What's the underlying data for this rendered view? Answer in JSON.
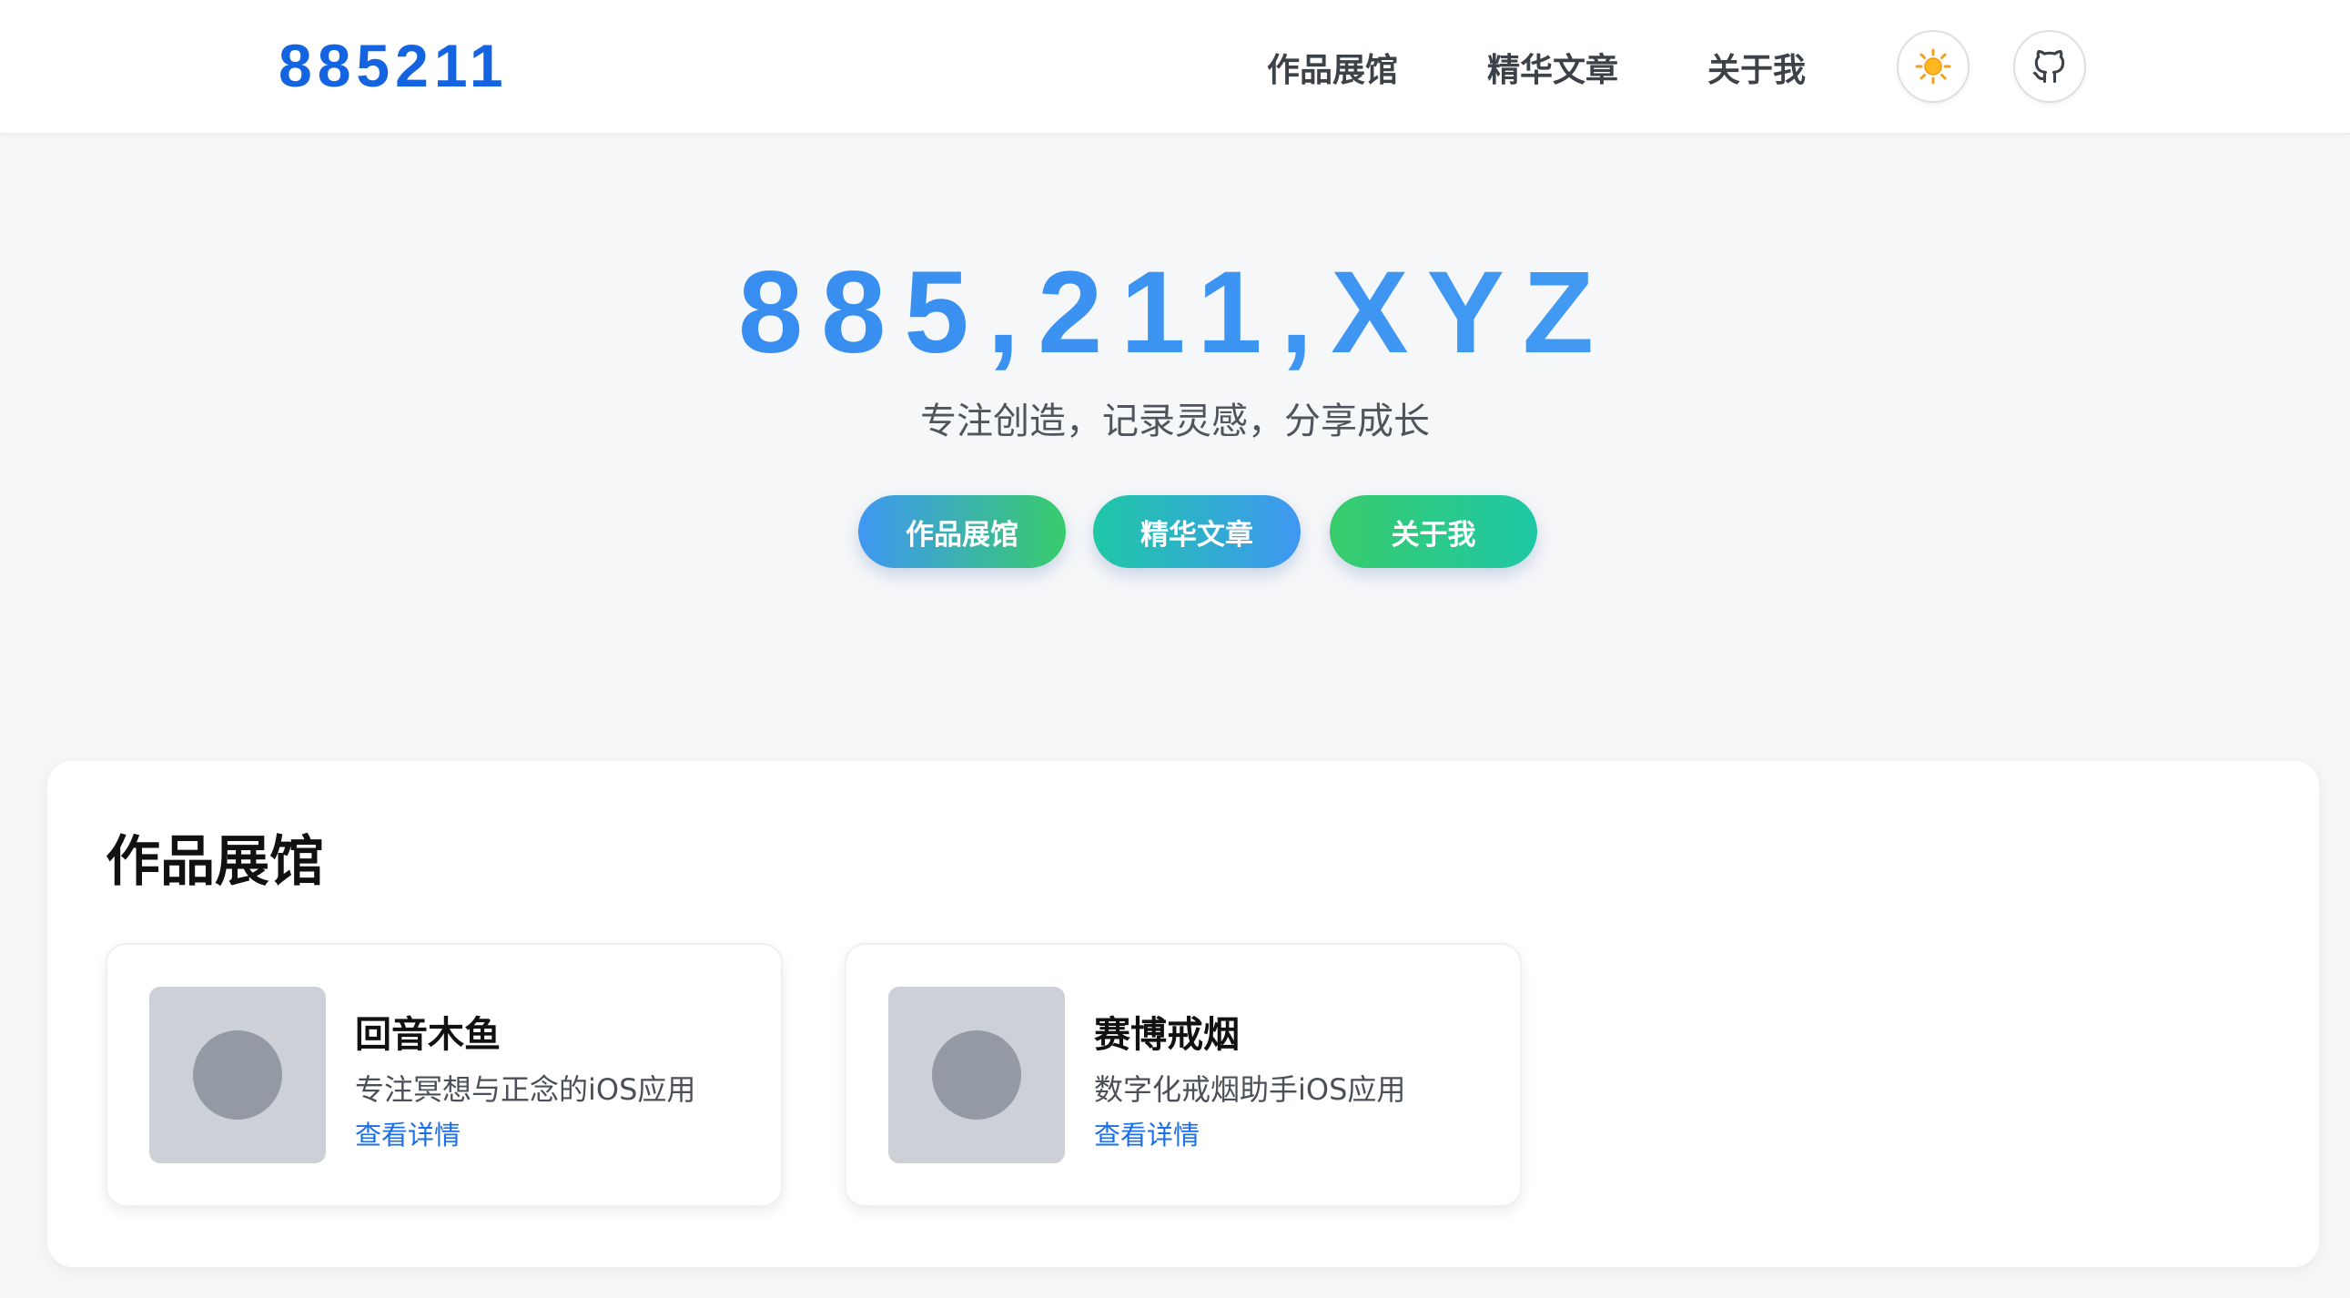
{
  "brand": {
    "logo": "885211"
  },
  "nav": {
    "items": [
      {
        "label": "作品展馆"
      },
      {
        "label": "精华文章"
      },
      {
        "label": "关于我"
      }
    ],
    "theme_icon": "sun-icon",
    "github_icon": "github-icon"
  },
  "hero": {
    "title": "885,211,XYZ",
    "subtitle": "专注创造，记录灵感，分享成长",
    "buttons": [
      {
        "label": "作品展馆"
      },
      {
        "label": "精华文章"
      },
      {
        "label": "关于我"
      }
    ]
  },
  "showcase": {
    "title": "作品展馆",
    "cards": [
      {
        "title": "回音木鱼",
        "description": "专注冥想与正念的iOS应用",
        "link": "查看详情"
      },
      {
        "title": "赛博戒烟",
        "description": "数字化戒烟助手iOS应用",
        "link": "查看详情"
      }
    ]
  },
  "colors": {
    "brand_blue": "#1463e0",
    "hero_blue": "#3d8ef0",
    "link_blue": "#1c6fe6",
    "teal": "#1fc7a6",
    "green": "#38cc6b"
  }
}
